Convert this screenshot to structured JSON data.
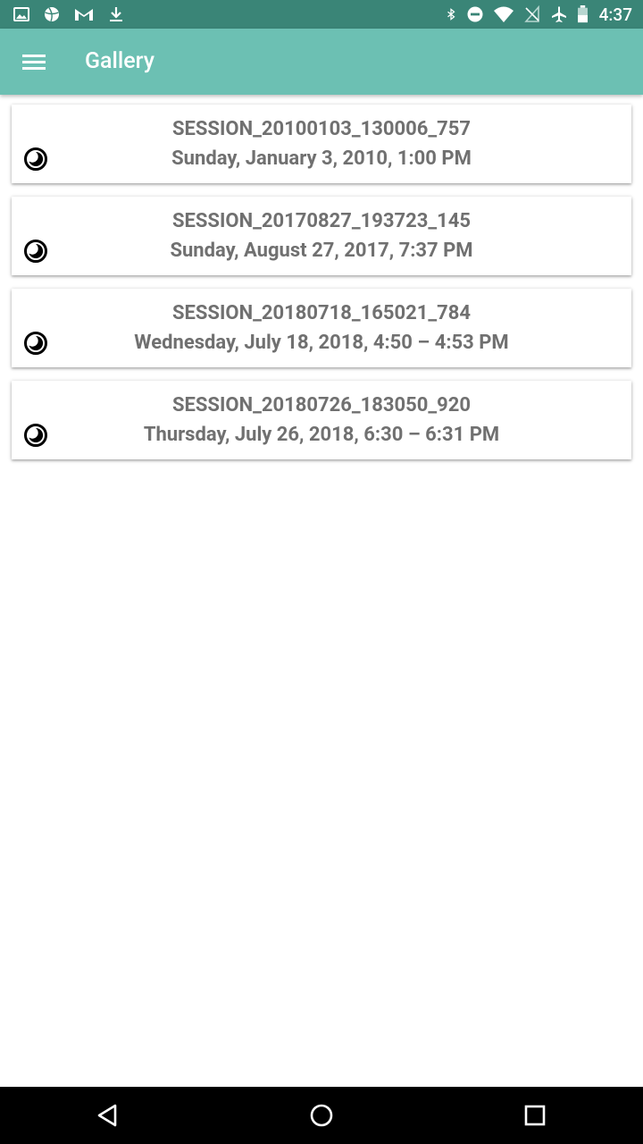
{
  "status_bar": {
    "time": "4:37",
    "left_icons": [
      "image-icon",
      "basketball-icon",
      "gmail-icon",
      "download-icon"
    ],
    "right_icons": [
      "bluetooth-icon",
      "do-not-disturb-icon",
      "wifi-icon",
      "no-sim-icon",
      "airplane-icon",
      "battery-icon"
    ]
  },
  "app_bar": {
    "title": "Gallery",
    "menu_icon": "hamburger-menu-icon",
    "background": "#6cc0b3"
  },
  "sessions": [
    {
      "name": "SESSION_20100103_130006_757",
      "date": "Sunday, January 3, 2010, 1:00 PM",
      "icon": "moon-clock-icon"
    },
    {
      "name": "SESSION_20170827_193723_145",
      "date": "Sunday, August 27, 2017, 7:37 PM",
      "icon": "moon-clock-icon"
    },
    {
      "name": "SESSION_20180718_165021_784",
      "date": "Wednesday, July 18, 2018, 4:50 – 4:53 PM",
      "icon": "moon-clock-icon"
    },
    {
      "name": "SESSION_20180726_183050_920",
      "date": "Thursday, July 26, 2018, 6:30 – 6:31 PM",
      "icon": "moon-clock-icon"
    }
  ],
  "nav_bar": {
    "buttons": [
      "back-icon",
      "home-icon",
      "recents-icon"
    ]
  },
  "colors": {
    "status_bar": "#3a8577",
    "app_bar": "#6cc0b3",
    "text_gray": "#707070"
  }
}
